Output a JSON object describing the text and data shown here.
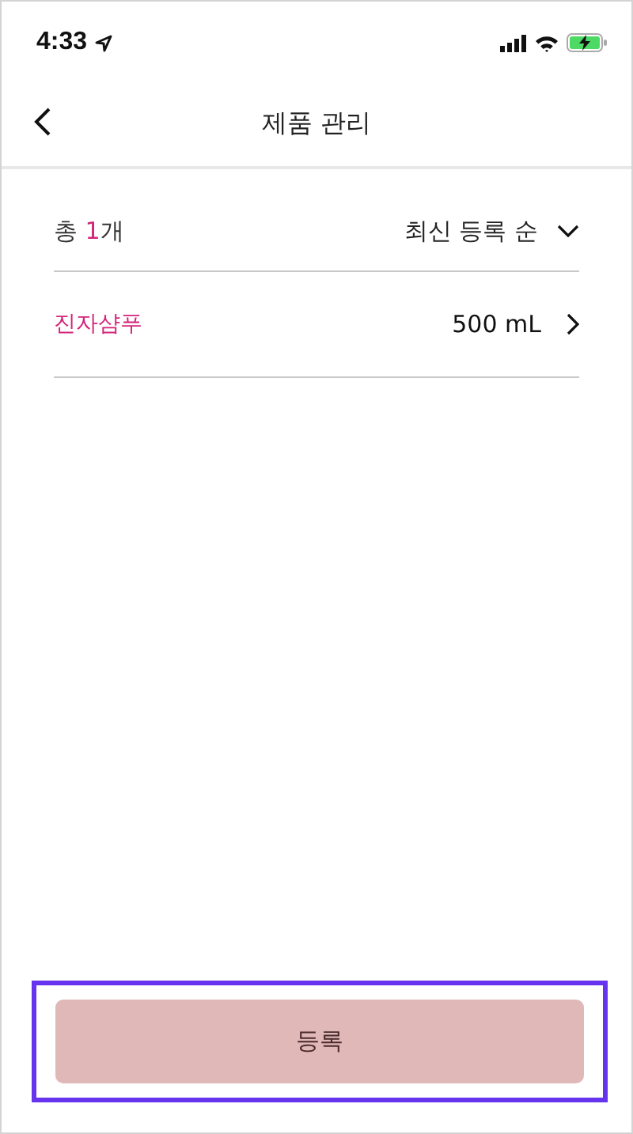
{
  "status_bar": {
    "time": "4:33"
  },
  "header": {
    "title": "제품 관리"
  },
  "summary": {
    "prefix": "총 ",
    "count": "1",
    "suffix": "개",
    "sort": "최신 등록 순"
  },
  "products": [
    {
      "name": "진자샴푸",
      "volume": "500 mL"
    }
  ],
  "register_button": {
    "label": "등록",
    "disabled": true,
    "highlighted": true
  }
}
